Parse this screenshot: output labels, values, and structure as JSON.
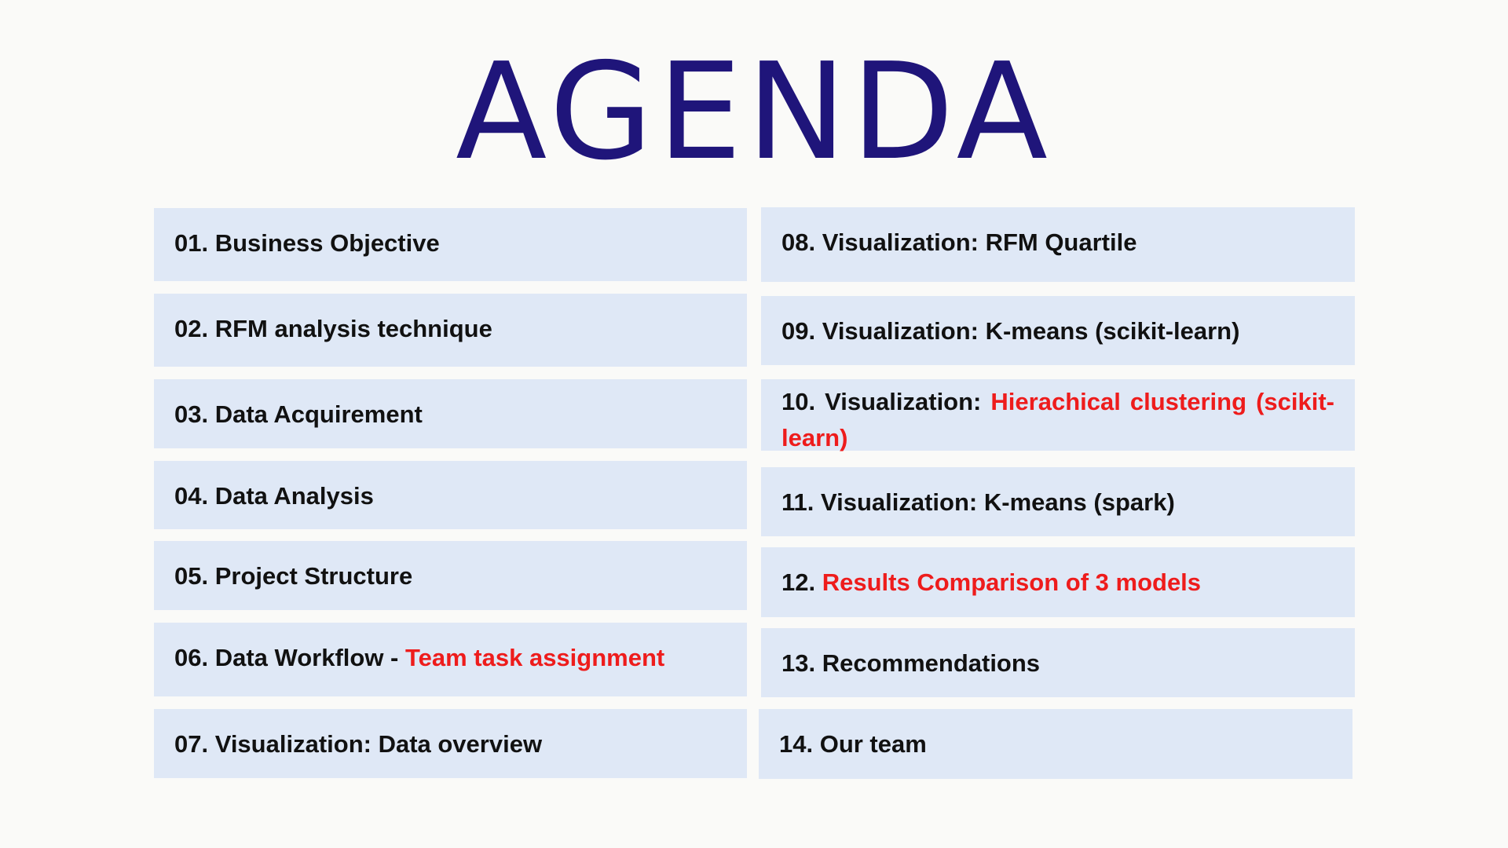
{
  "title": "AGENDA",
  "accent_color": "#1f157a",
  "highlight_color": "#ee1c1c",
  "left_items": [
    {
      "label": "01. Business Objective",
      "highlight": ""
    },
    {
      "label": "02. RFM analysis technique",
      "highlight": ""
    },
    {
      "label": "03. Data Acquirement",
      "highlight": ""
    },
    {
      "label": "04. Data Analysis",
      "highlight": ""
    },
    {
      "label": "05. Project Structure",
      "highlight": ""
    },
    {
      "label": "06. Data Workflow - ",
      "highlight": "Team task assignment"
    },
    {
      "label": "07. Visualization: Data overview",
      "highlight": ""
    }
  ],
  "right_items": [
    {
      "label": "08. Visualization: RFM Quartile",
      "highlight": ""
    },
    {
      "label": "09. Visualization: K-means (scikit-learn)",
      "highlight": ""
    },
    {
      "label": "10. Visualization: ",
      "highlight": "Hierachical clustering (scikit-learn)"
    },
    {
      "label": "11. Visualization: K-means (spark)",
      "highlight": ""
    },
    {
      "label": "12. ",
      "highlight": "Results Comparison of 3 models"
    },
    {
      "label": "13. Recommendations",
      "highlight": ""
    },
    {
      "label": "14. Our team",
      "highlight": ""
    }
  ]
}
